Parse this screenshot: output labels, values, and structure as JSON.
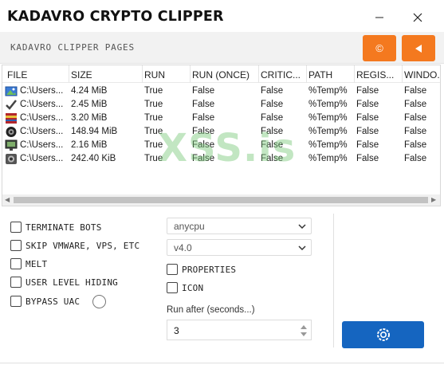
{
  "window": {
    "title": "KADAVRO CRYPTO CLIPPER",
    "minimize_glyph": "—",
    "close_glyph": "✕"
  },
  "subheader": {
    "label": "KADAVRO CLIPPER PAGES",
    "copyright_icon": "copyright-icon",
    "back_icon": "back-arrow-icon"
  },
  "table": {
    "columns": [
      "FILE",
      "SIZE",
      "RUN",
      "RUN (ONCE)",
      "CRITIC...",
      "PATH",
      "REGIS...",
      "WINDO..."
    ],
    "rows": [
      {
        "icon": "image-file-icon",
        "file": "C:\\Users...",
        "size": "4.24 MiB",
        "run": "True",
        "run_once": "False",
        "critical": "False",
        "path": "%Temp%",
        "registry": "False",
        "window": "False"
      },
      {
        "icon": "checkmark-file-icon",
        "file": "C:\\Users...",
        "size": "2.45 MiB",
        "run": "True",
        "run_once": "False",
        "critical": "False",
        "path": "%Temp%",
        "registry": "False",
        "window": "False"
      },
      {
        "icon": "archive-file-icon",
        "file": "C:\\Users...",
        "size": "3.20 MiB",
        "run": "True",
        "run_once": "False",
        "critical": "False",
        "path": "%Temp%",
        "registry": "False",
        "window": "False"
      },
      {
        "icon": "game-file-icon",
        "file": "C:\\Users...",
        "size": "148.94 MiB",
        "run": "True",
        "run_once": "False",
        "critical": "False",
        "path": "%Temp%",
        "registry": "False",
        "window": "False"
      },
      {
        "icon": "monitor-file-icon",
        "file": "C:\\Users...",
        "size": "2.16 MiB",
        "run": "True",
        "run_once": "False",
        "critical": "False",
        "path": "%Temp%",
        "registry": "False",
        "window": "False"
      },
      {
        "icon": "app-file-icon",
        "file": "C:\\Users...",
        "size": "242.40 KiB",
        "run": "True",
        "run_once": "False",
        "critical": "False",
        "path": "%Temp%",
        "registry": "False",
        "window": "False"
      }
    ]
  },
  "watermark": "XSS.is",
  "options": {
    "terminate_bots": "TERMINATE BOTS",
    "skip_vm": "SKIP VMWARE, VPS, ETC",
    "melt": "MELT",
    "user_level_hiding": "USER LEVEL HIDING",
    "bypass_uac": "BYPASS UAC",
    "properties": "PROPERTIES",
    "icon": "ICON"
  },
  "platform_select": {
    "value": "anycpu"
  },
  "framework_select": {
    "value": "v4.0"
  },
  "run_after": {
    "label": "Run after (seconds...)",
    "value": "3"
  },
  "build_button": {
    "icon": "build-gear-icon"
  },
  "colors": {
    "accent_orange": "#f4791f",
    "accent_blue": "#1565c0"
  }
}
